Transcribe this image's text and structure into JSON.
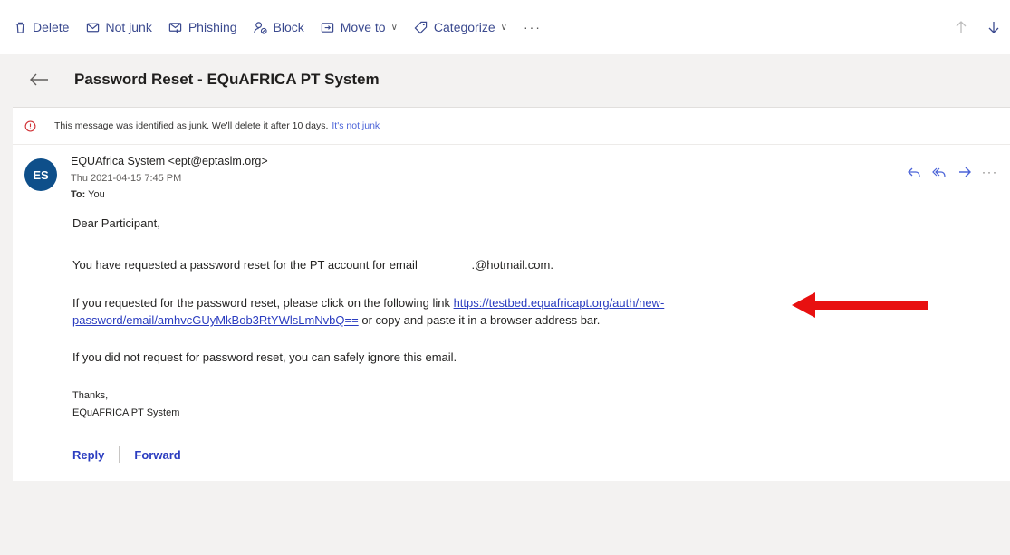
{
  "toolbar": {
    "items": [
      {
        "label": "Delete",
        "icon": "trash-icon"
      },
      {
        "label": "Not junk",
        "icon": "envelope-icon"
      },
      {
        "label": "Phishing",
        "icon": "phishing-icon"
      },
      {
        "label": "Block",
        "icon": "block-person-icon"
      },
      {
        "label": "Move to",
        "icon": "folder-move-icon"
      },
      {
        "label": "Categorize",
        "icon": "tag-icon"
      }
    ],
    "more": "···"
  },
  "subject": "Password Reset - EQuAFRICA PT System",
  "junk_banner": {
    "text": "This message was identified as junk. We'll delete it after 10 days.",
    "link": "It's not junk"
  },
  "message": {
    "avatar_initials": "ES",
    "sender": "EQUAfrica System <ept@eptaslm.org>",
    "date": "Thu 2021-04-15 7:45 PM",
    "to_label": "To:",
    "to_value": "You",
    "greeting": "Dear Participant,",
    "para1_start": "You have requested a password reset for the PT account for email",
    "para1_email": ".@hotmail.com.",
    "para2_start": "If you requested for the password reset, please click on the following link",
    "reset_link": "https://testbed.equafricapt.org/auth/new-password/email/amhvcGUyMkBob3RtYWlsLmNvbQ==",
    "para2_end": "or copy and paste it in a browser address bar.",
    "para3": "If you did not request for password reset, you can safely ignore this email.",
    "signoff": "Thanks,",
    "signature": "EQuAFRICA PT System"
  },
  "actions": {
    "reply": "Reply",
    "forward": "Forward"
  },
  "colors": {
    "accent": "#3b4a8f",
    "link": "#2b3dc0",
    "avatar": "#0e4f8a",
    "annotation_arrow": "#e81010"
  }
}
